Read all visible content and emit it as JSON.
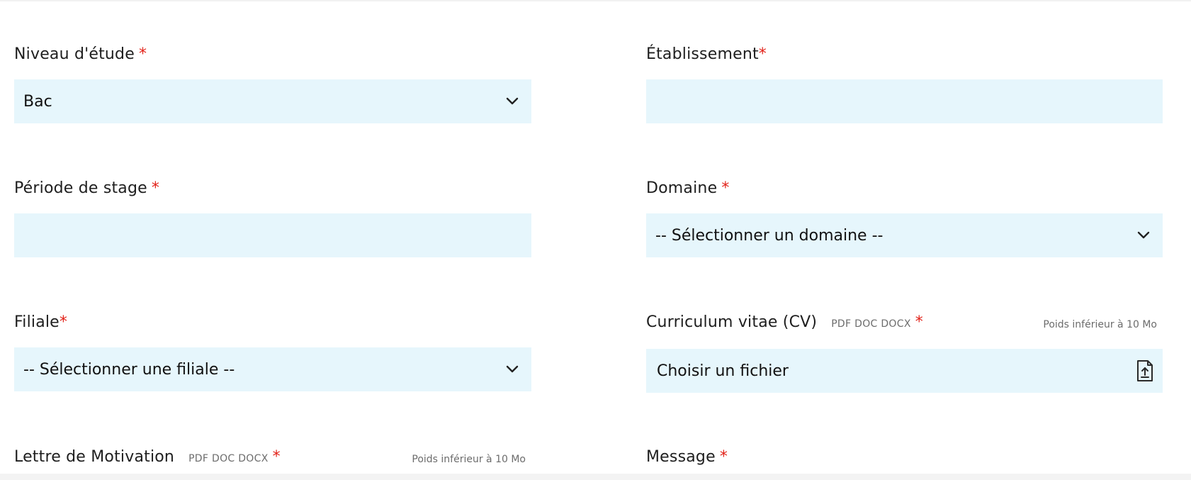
{
  "form": {
    "niveau": {
      "label": "Niveau d'étude",
      "required": "*",
      "value": "Bac"
    },
    "etablissement": {
      "label": "Établissement",
      "required": "*",
      "value": ""
    },
    "periode": {
      "label": "Période de stage",
      "required": "*",
      "value": ""
    },
    "domaine": {
      "label": "Domaine",
      "required": "*",
      "value": "-- Sélectionner un domaine --"
    },
    "filiale": {
      "label": "Filiale",
      "required": "*",
      "value": "-- Sélectionner une filiale --"
    },
    "cv": {
      "label": "Curriculum vitae (CV)",
      "formats": "PDF DOC DOCX",
      "required": "*",
      "weight": "Poids inférieur à 10 Mo",
      "button": "Choisir un fichier"
    },
    "lettre": {
      "label": "Lettre de Motivation",
      "formats": "PDF DOC DOCX",
      "required": "*",
      "weight": "Poids inférieur à 10 Mo"
    },
    "message": {
      "label": "Message",
      "required": "*"
    }
  },
  "colors": {
    "field_bg": "#e6f6fc",
    "required": "#e2231a",
    "text": "#1e1e1e",
    "muted": "#6c6c6c"
  },
  "icons": {
    "select": "chevron-down-icon",
    "upload": "file-upload-icon"
  }
}
